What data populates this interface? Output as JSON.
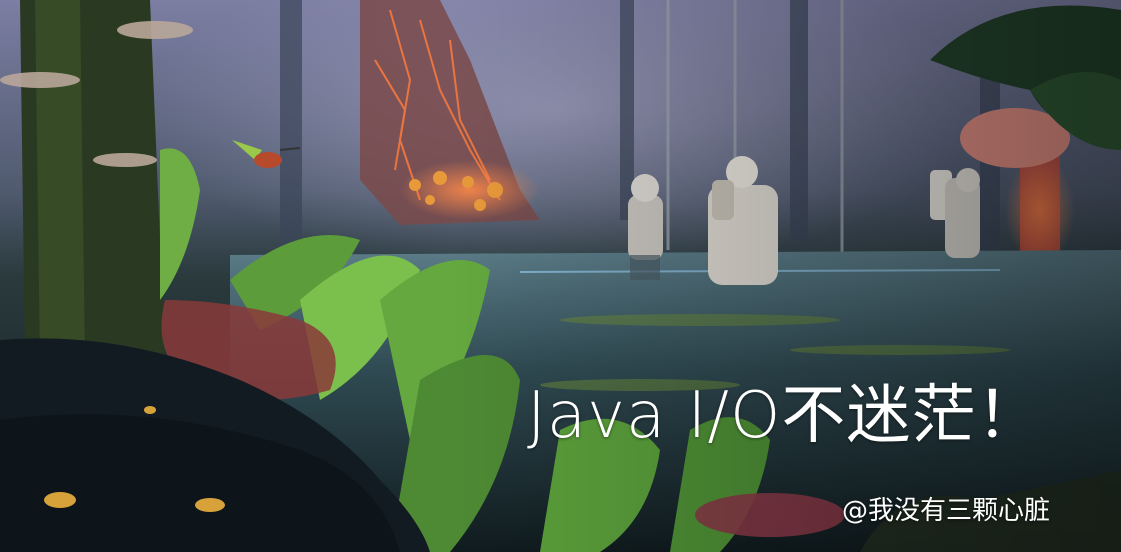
{
  "banner": {
    "title": "Java I/O不迷茫！",
    "credit": "@我没有三颗心脏"
  },
  "scene": {
    "subjects": [
      "astronaut",
      "astronaut",
      "astronaut",
      "hummingbird",
      "tropical-leaves",
      "glowing-mushroom",
      "jungle-pool"
    ],
    "colors": {
      "sky_haze": "#8a8fb0",
      "jungle_dark": "#1d2a2a",
      "water": "#3c5a66",
      "leaf_green": "#5fa83a",
      "glow_orange": "#e0693a",
      "mushroom_red": "#c94a3a",
      "text": "#ffffff"
    }
  }
}
